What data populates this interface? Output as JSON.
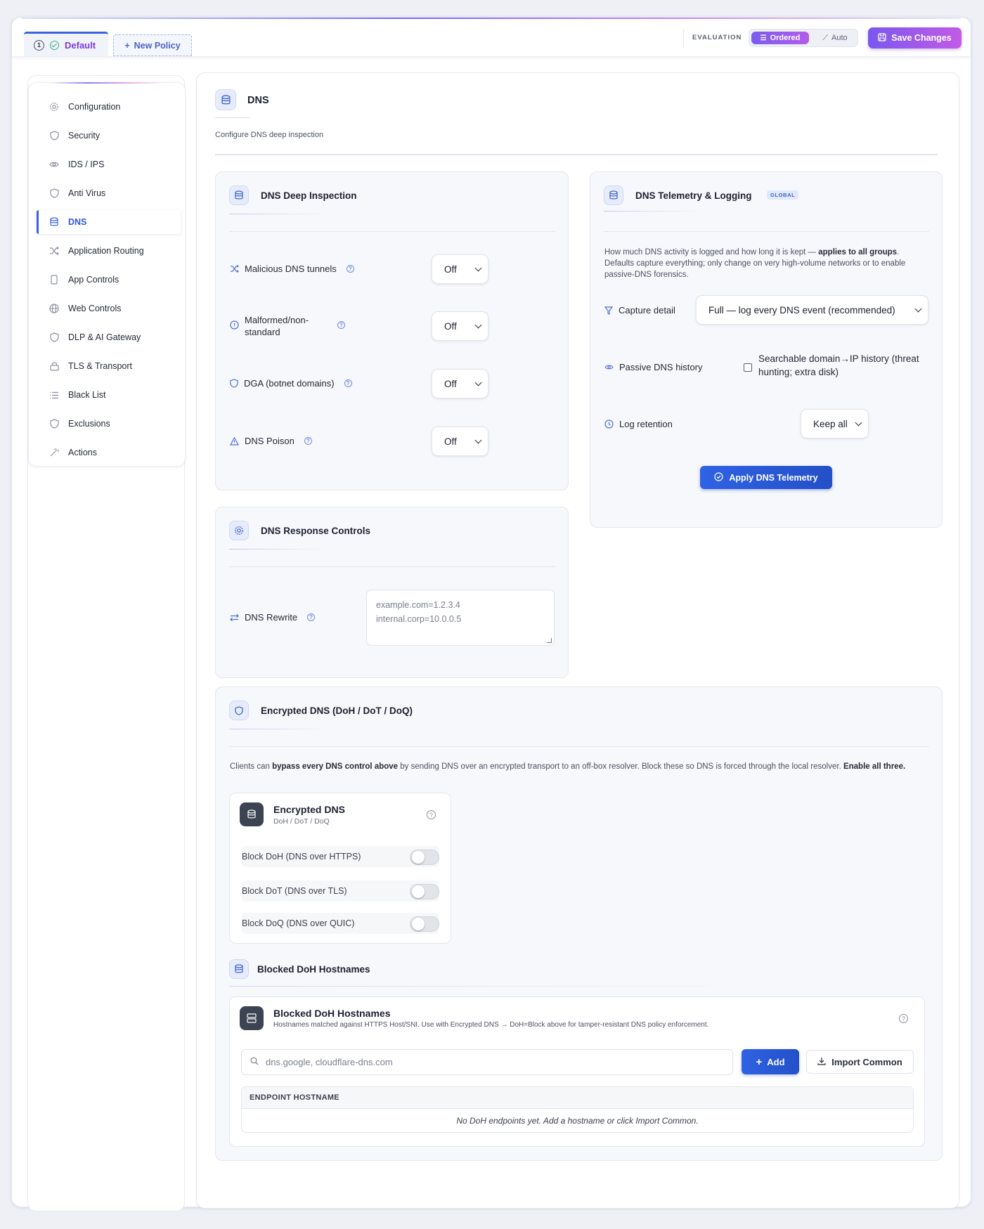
{
  "topbar": {
    "tabs": [
      {
        "num": "1",
        "label": "Default"
      },
      {
        "label": "New Policy"
      }
    ],
    "evaluation_label": "EVALUATION",
    "eval_modes": [
      "Ordered",
      "Auto"
    ],
    "save_label": "Save Changes"
  },
  "sidebar": {
    "items": [
      {
        "label": "Configuration",
        "icon": "gear-icon"
      },
      {
        "label": "Security",
        "icon": "shield-icon"
      },
      {
        "label": "IDS / IPS",
        "icon": "eye-icon"
      },
      {
        "label": "Anti Virus",
        "icon": "shield-icon"
      },
      {
        "label": "DNS",
        "icon": "database-icon",
        "active": true
      },
      {
        "label": "Application Routing",
        "icon": "shuffle-icon"
      },
      {
        "label": "App Controls",
        "icon": "phone-icon"
      },
      {
        "label": "Web Controls",
        "icon": "globe-icon"
      },
      {
        "label": "DLP & AI Gateway",
        "icon": "shield-icon"
      },
      {
        "label": "TLS & Transport",
        "icon": "lock-icon"
      },
      {
        "label": "Black List",
        "icon": "list-icon"
      },
      {
        "label": "Exclusions",
        "icon": "shield-icon"
      },
      {
        "label": "Actions",
        "icon": "wand-icon"
      }
    ]
  },
  "header": {
    "title": "DNS",
    "subtitle": "Configure DNS deep inspection"
  },
  "deep_inspection": {
    "title": "DNS Deep Inspection",
    "rows": [
      {
        "label": "Malicious DNS tunnels",
        "value": "Off"
      },
      {
        "label": "Malformed/non-standard",
        "value": "Off"
      },
      {
        "label": "DGA (botnet domains)",
        "value": "Off"
      },
      {
        "label": "DNS Poison",
        "value": "Off"
      }
    ]
  },
  "telemetry": {
    "title": "DNS Telemetry & Logging",
    "badge": "GLOBAL",
    "desc_pre": "How much DNS activity is logged and how long it is kept — ",
    "desc_bold": "applies to all groups",
    "desc_post": ". Defaults capture everything; only change on very high-volume networks or to enable passive-DNS forensics.",
    "capture_label": "Capture detail",
    "capture_value": "Full — log every DNS event (recommended)",
    "passive_label": "Passive DNS history",
    "passive_checkbox": "Searchable domain→IP history (threat hunting; extra disk)",
    "retention_label": "Log retention",
    "retention_value": "Keep all",
    "apply_label": "Apply DNS Telemetry"
  },
  "response": {
    "title": "DNS Response Controls",
    "rewrite_label": "DNS Rewrite",
    "rewrite_placeholder": "example.com=1.2.3.4\ninternal.corp=10.0.0.5"
  },
  "encrypted": {
    "title": "Encrypted DNS (DoH / DoT / DoQ)",
    "desc_pre": "Clients can ",
    "desc_bold1": "bypass every DNS control above",
    "desc_mid": " by sending DNS over an encrypted transport to an off-box resolver. Block these so DNS is forced through the local resolver. ",
    "desc_bold2": "Enable all three.",
    "box_title": "Encrypted DNS",
    "box_sub": "DoH / DoT / DoQ",
    "toggles": [
      {
        "label": "Block DoH (DNS over HTTPS)",
        "on": false
      },
      {
        "label": "Block DoT (DNS over TLS)",
        "on": false
      },
      {
        "label": "Block DoQ (DNS over QUIC)",
        "on": false
      }
    ]
  },
  "blocked": {
    "section_title": "Blocked DoH Hostnames",
    "box_title": "Blocked DoH Hostnames",
    "box_desc": "Hostnames matched against HTTPS Host/SNI. Use with Encrypted DNS → DoH=Block above for tamper-resistant DNS policy enforcement.",
    "search_placeholder": "dns.google, cloudflare-dns.com",
    "add_label": "Add",
    "import_label": "Import Common",
    "column": "ENDPOINT HOSTNAME",
    "empty": "No DoH endpoints yet. Add a hostname or click Import Common."
  },
  "colors": {
    "accent": "#3b63e0",
    "brand": "#7a57ef"
  }
}
